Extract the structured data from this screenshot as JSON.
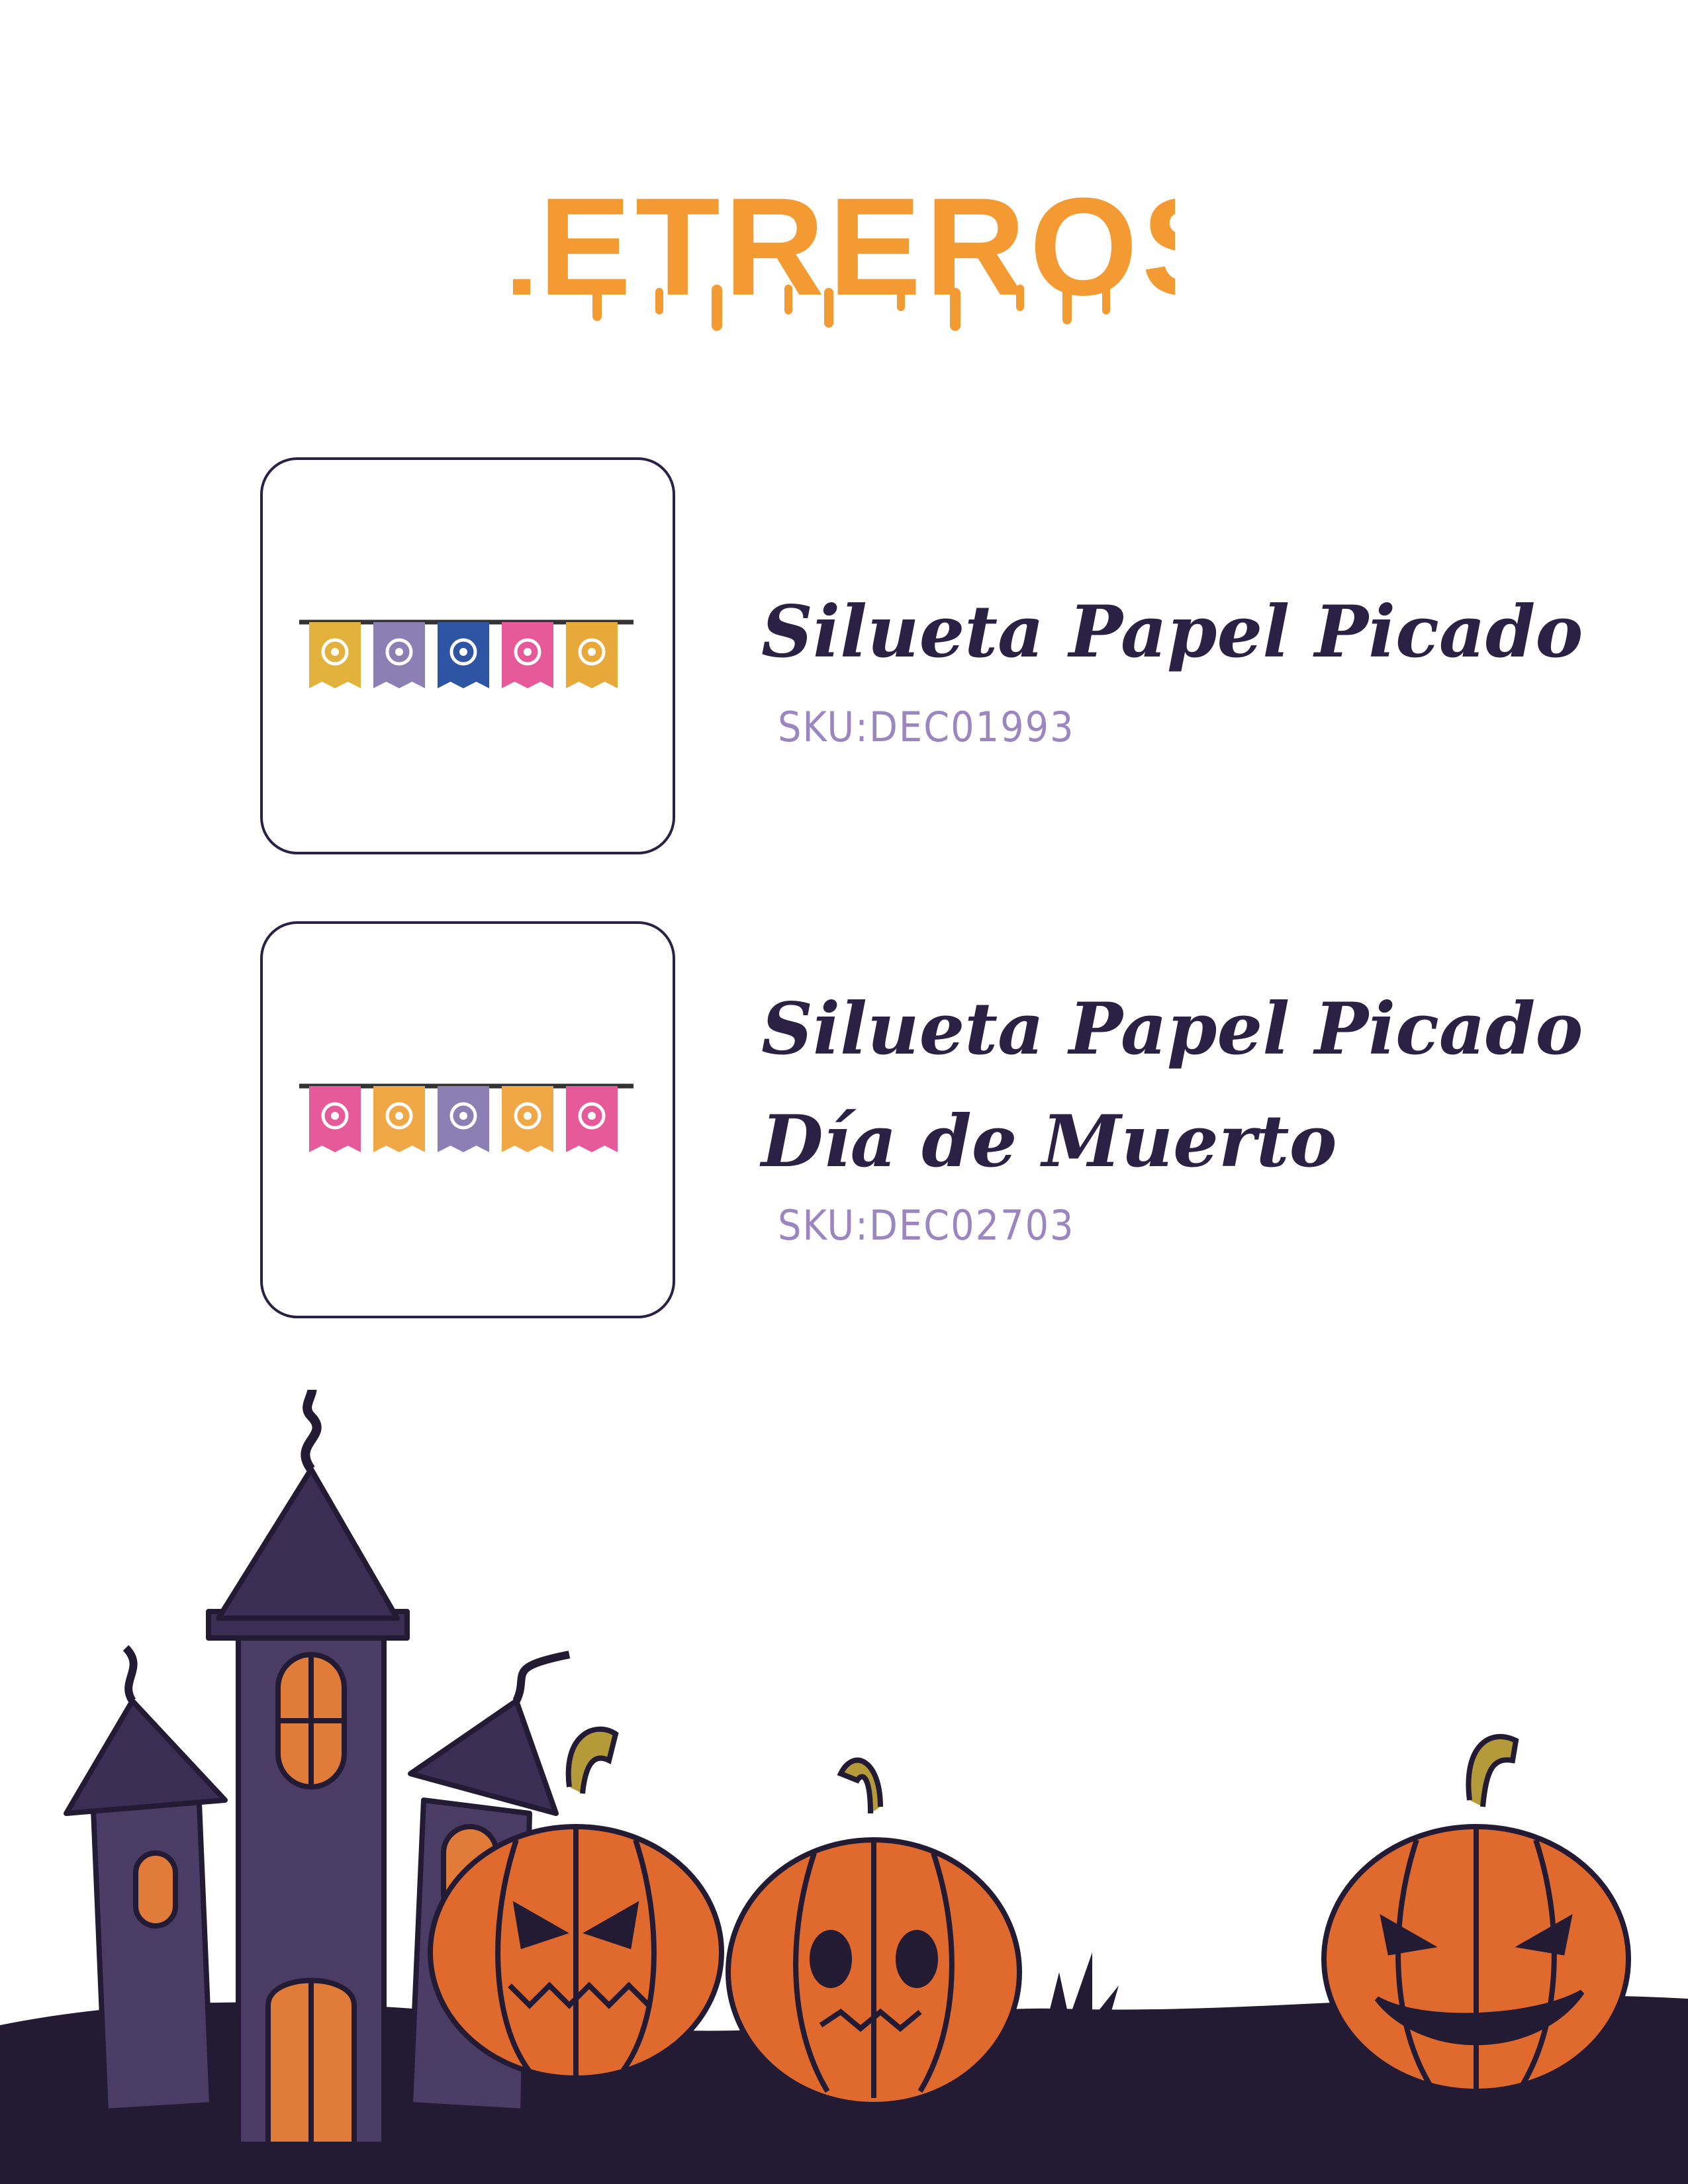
{
  "page": {
    "title": "LETREROS"
  },
  "colors": {
    "title_orange": "#f39a33",
    "text_dark": "#2a2144",
    "sku_purple": "#9b86c2",
    "ground": "#231a33",
    "castle_purple": "#4b3c66",
    "castle_roof": "#3a2e55",
    "window_orange": "#e07b3a",
    "pumpkin_orange": "#e06a2e",
    "stem": "#b59a3a"
  },
  "products": [
    {
      "name_lines": [
        "Silueta Papel Picado"
      ],
      "sku": "SKU:DEC01993",
      "flags": [
        "#e3b23c",
        "#8b7fb3",
        "#2e55a3",
        "#e75a9a",
        "#e6a93a"
      ]
    },
    {
      "name_lines": [
        "Silueta Papel Picado",
        "Día de Muerto"
      ],
      "sku": "SKU:DEC02703",
      "flags": [
        "#e75a9a",
        "#f0a846",
        "#8b7fb3",
        "#f0a846",
        "#e75a9a"
      ]
    }
  ]
}
